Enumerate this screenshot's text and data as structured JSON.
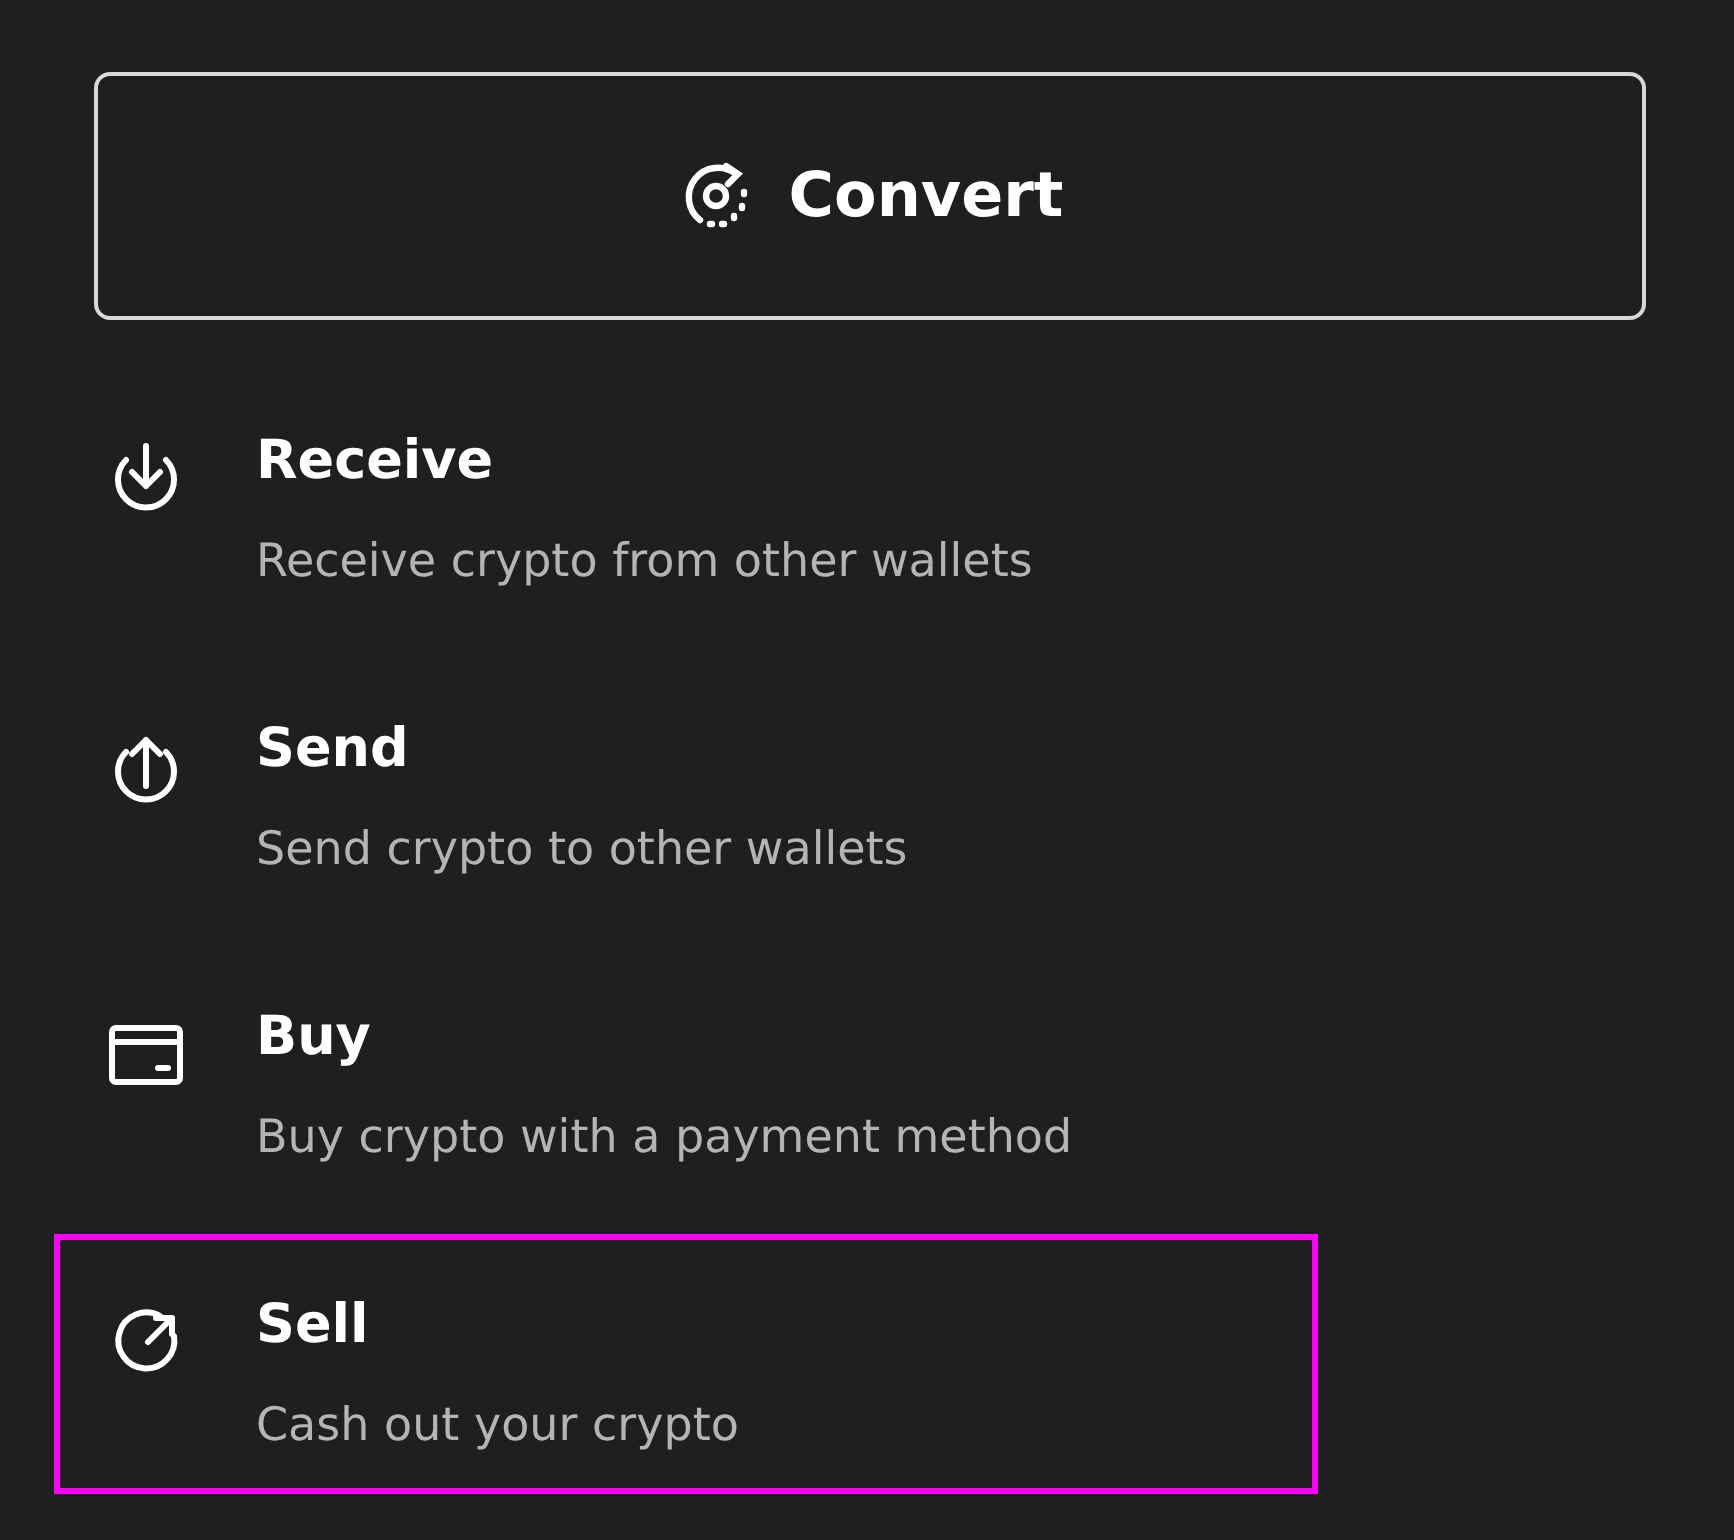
{
  "convert_button": {
    "label": "Convert"
  },
  "actions": [
    {
      "kind": "receive",
      "title": "Receive",
      "subtitle": "Receive crypto from other wallets",
      "selected": false
    },
    {
      "kind": "send",
      "title": "Send",
      "subtitle": "Send crypto to other wallets",
      "selected": false
    },
    {
      "kind": "buy",
      "title": "Buy",
      "subtitle": "Buy crypto with a payment method",
      "selected": false
    },
    {
      "kind": "sell",
      "title": "Sell",
      "subtitle": "Cash out your crypto",
      "selected": true
    }
  ]
}
